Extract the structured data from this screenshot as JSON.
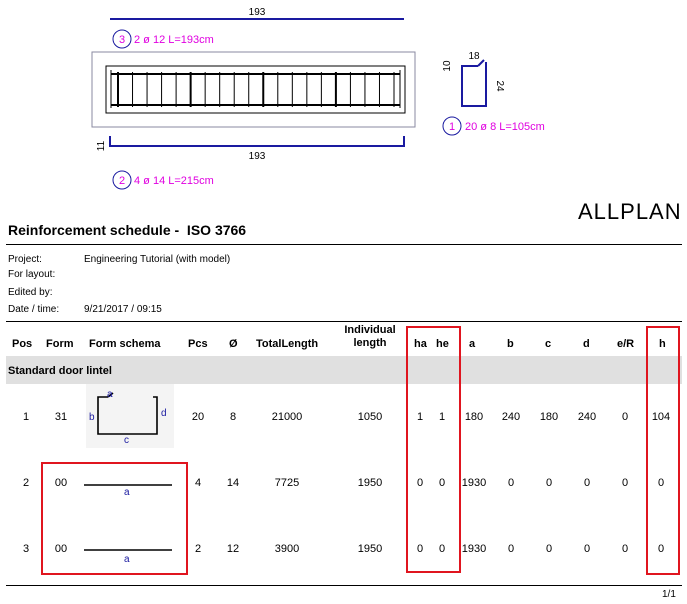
{
  "drawing": {
    "top_dim": "193",
    "bottom_dim": "193",
    "side_dim": "11",
    "bar3_pos": "3",
    "bar3_label": "2 ø 12 L=193cm",
    "bar2_pos": "2",
    "bar2_label": "4 ø 14 L=215cm",
    "bar1_pos": "1",
    "bar1_label": "20 ø 8 L=105cm",
    "stirrup_w": "18",
    "stirrup_h": "24",
    "stirrup_hook": "10",
    "accent_color": "#e000e0",
    "line_color": "#1a1aa0"
  },
  "logo": "ALLPLAN",
  "title": "Reinforcement schedule -  ISO 3766",
  "meta": {
    "project_label": "Project:",
    "project_value": "Engineering Tutorial (with model)",
    "layout_label": "For layout:",
    "edited_label": "Edited by:",
    "date_label": "Date / time:",
    "date_value": "9/21/2017  /  09:15"
  },
  "headers": {
    "pos": "Pos",
    "form": "Form",
    "schema": "Form schema",
    "pcs": "Pcs",
    "dia": "Ø",
    "total": "TotalLength",
    "individual_1": "Individual",
    "individual_2": "length",
    "ha": "ha",
    "he": "he",
    "a": "a",
    "b": "b",
    "c": "c",
    "d": "d",
    "er": "e/R",
    "h": "h"
  },
  "section": "Standard door lintel",
  "schema_letters": {
    "a": "a",
    "b": "b",
    "c": "c",
    "d": "d"
  },
  "rows": [
    {
      "pos": "1",
      "form": "31",
      "pcs": "20",
      "dia": "8",
      "total": "21000",
      "individual": "1050",
      "ha": "1",
      "he": "1",
      "a": "180",
      "b": "240",
      "c": "180",
      "d": "240",
      "er": "0",
      "h": "104"
    },
    {
      "pos": "2",
      "form": "00",
      "pcs": "4",
      "dia": "14",
      "total": "7725",
      "individual": "1950",
      "ha": "0",
      "he": "0",
      "a": "1930",
      "b": "0",
      "c": "0",
      "d": "0",
      "er": "0",
      "h": "0"
    },
    {
      "pos": "3",
      "form": "00",
      "pcs": "2",
      "dia": "12",
      "total": "3900",
      "individual": "1950",
      "ha": "0",
      "he": "0",
      "a": "1930",
      "b": "0",
      "c": "0",
      "d": "0",
      "er": "0",
      "h": "0"
    }
  ],
  "page": "1/1",
  "highlight_color": "#e0151f"
}
